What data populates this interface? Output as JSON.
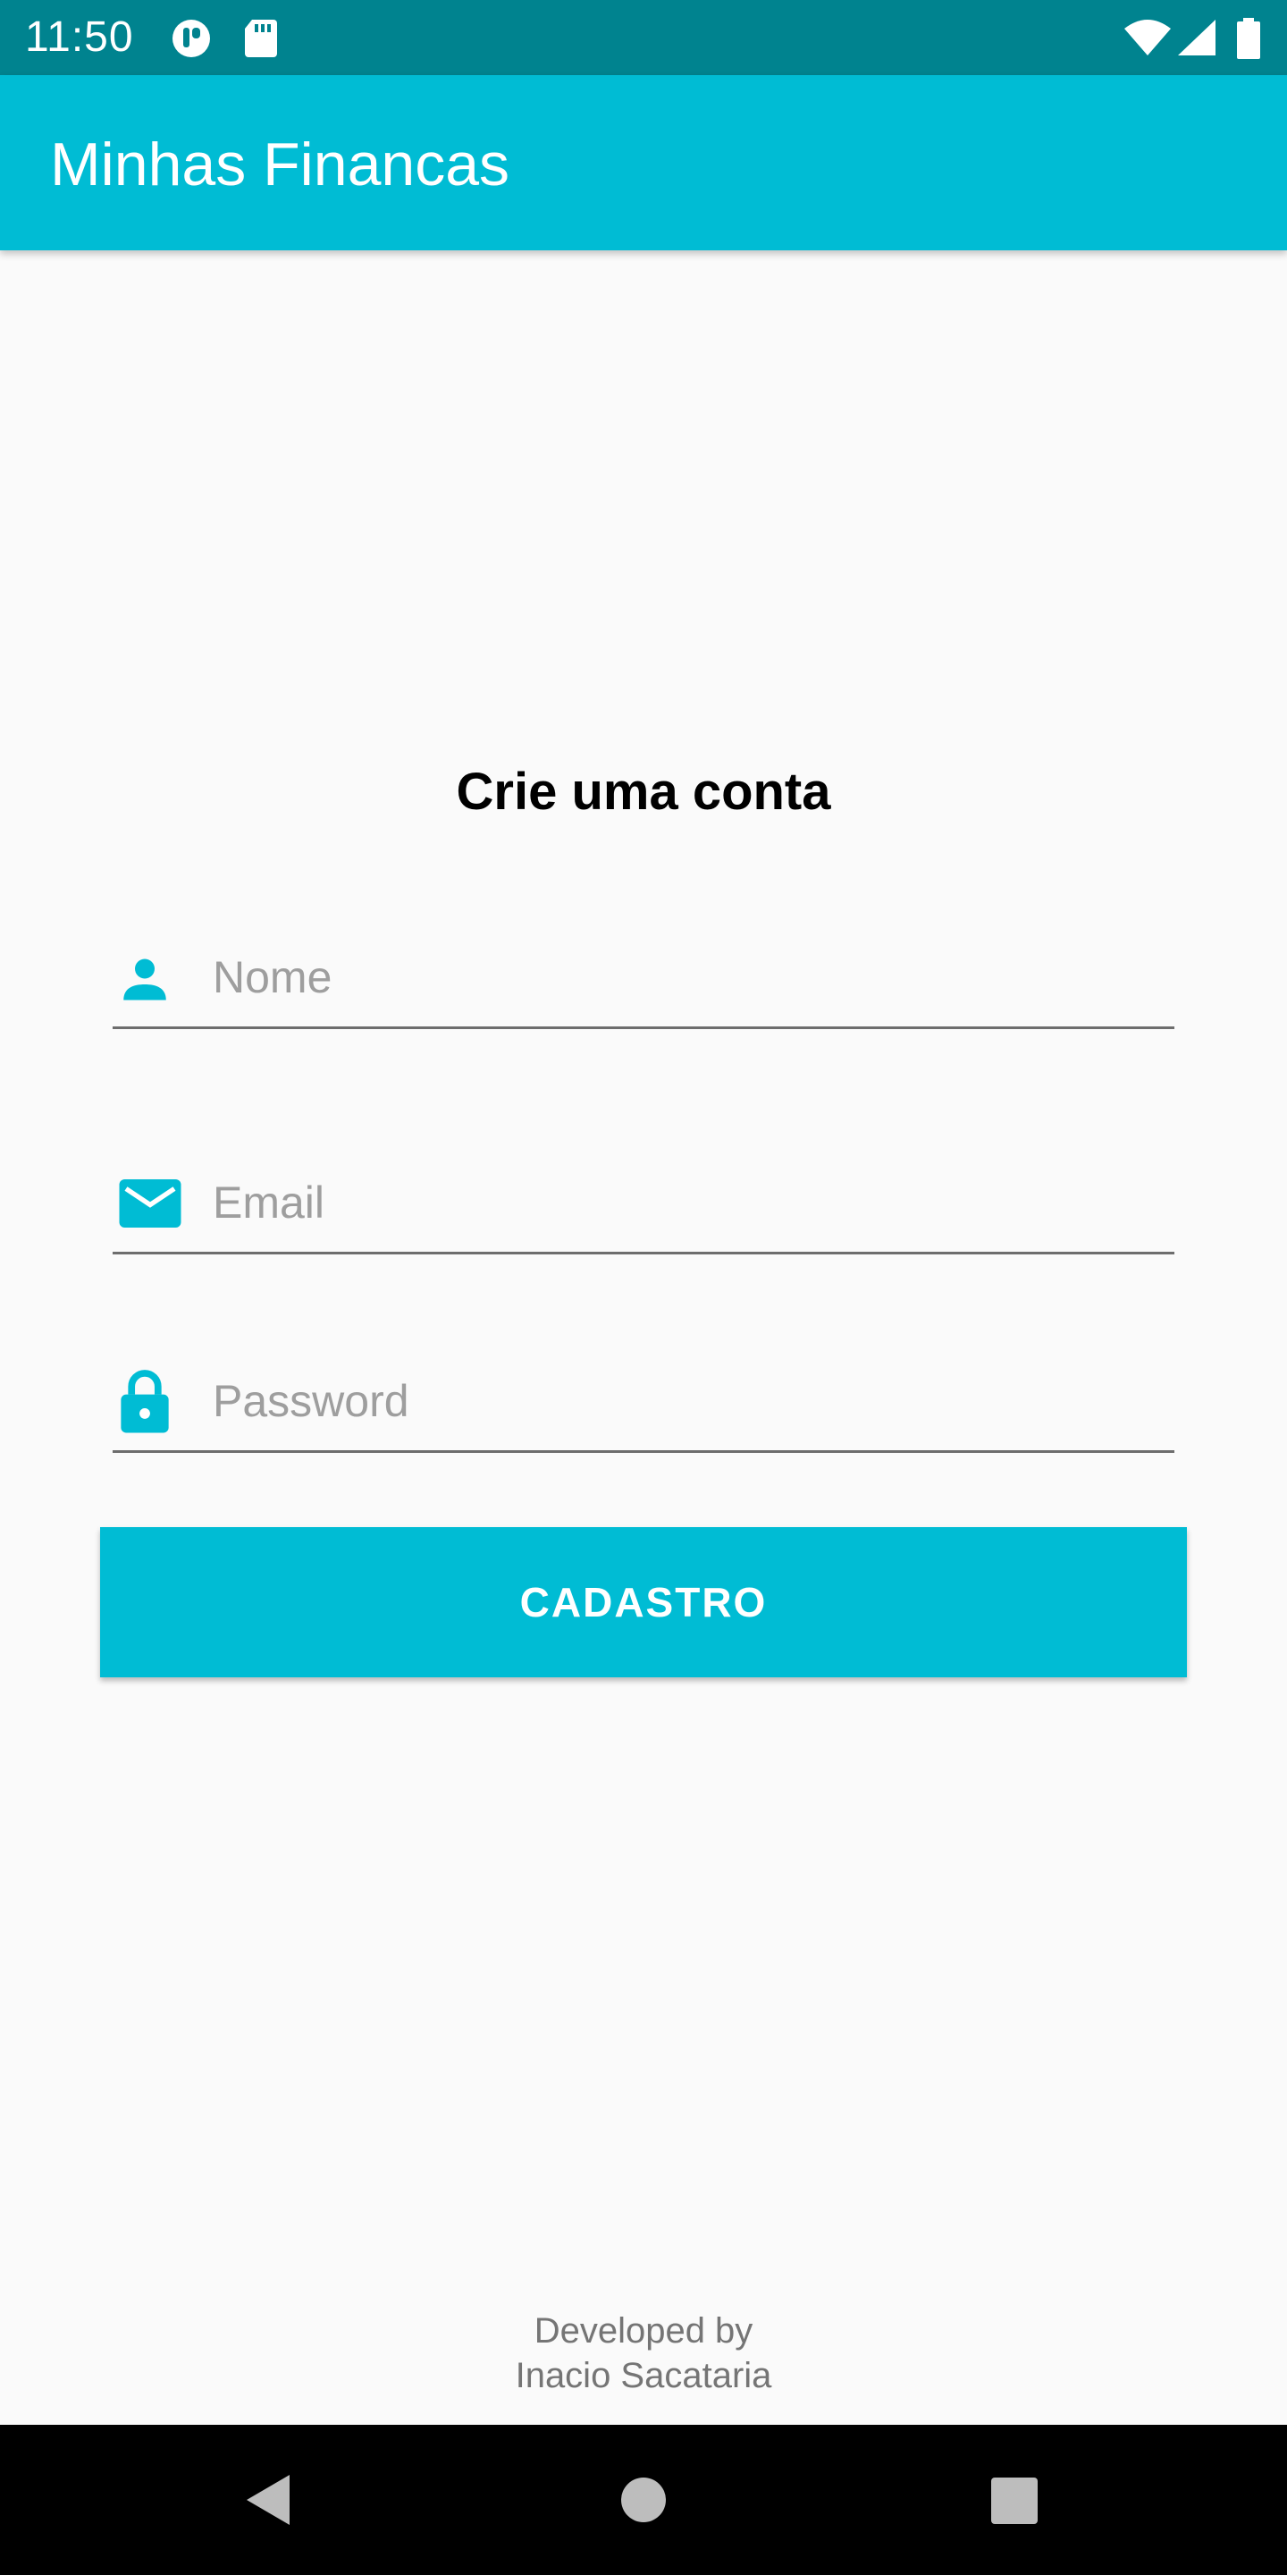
{
  "status_bar": {
    "time": "11:50",
    "left_icons": [
      "shield-app-icon",
      "sd-card-icon"
    ],
    "right_icons": [
      "wifi-icon",
      "cell-signal-icon",
      "battery-icon"
    ]
  },
  "app_bar": {
    "title": "Minhas Financas"
  },
  "form": {
    "heading": "Crie uma conta",
    "fields": [
      {
        "icon": "person-icon",
        "placeholder": "Nome",
        "value": ""
      },
      {
        "icon": "email-icon",
        "placeholder": "Email",
        "value": ""
      },
      {
        "icon": "lock-icon",
        "placeholder": "Password",
        "value": ""
      }
    ],
    "submit_label": "CADASTRO"
  },
  "footer": {
    "line1": "Developed by",
    "line2": "Inacio Sacataria"
  },
  "nav_bar": {
    "buttons": [
      "back-icon",
      "home-icon",
      "recents-icon"
    ]
  },
  "colors": {
    "primary": "#00bcd4",
    "primary_dark": "#00838f",
    "background": "#fafafa",
    "text": "#000000",
    "hint": "#9e9e9e"
  }
}
